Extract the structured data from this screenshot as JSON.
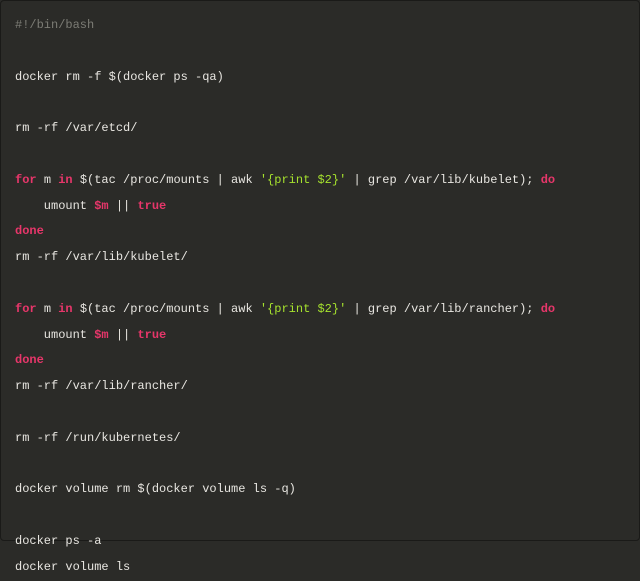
{
  "code": {
    "shebang": "#!/bin/bash",
    "docker_rm": "docker rm -f $(docker ps -qa)",
    "rm_etcd": "rm -rf /var/etcd/",
    "loop1": {
      "for": "for",
      "var": "m",
      "in": "in",
      "expr_pre": " $(tac /proc/mounts | awk ",
      "awk_str": "'{print $2}'",
      "expr_post": " | grep /var/lib/kubelet); ",
      "do": "do",
      "body_pre": "    umount ",
      "body_var": "$m",
      "body_mid": " || ",
      "body_true": "true",
      "done": "done"
    },
    "rm_kubelet": "rm -rf /var/lib/kubelet/",
    "loop2": {
      "for": "for",
      "var": "m",
      "in": "in",
      "expr_pre": " $(tac /proc/mounts | awk ",
      "awk_str": "'{print $2}'",
      "expr_post": " | grep /var/lib/rancher); ",
      "do": "do",
      "body_pre": "    umount ",
      "body_var": "$m",
      "body_mid": " || ",
      "body_true": "true",
      "done": "done"
    },
    "rm_rancher": "rm -rf /var/lib/rancher/",
    "rm_kubernetes": "rm -rf /run/kubernetes/",
    "docker_vol_rm": "docker volume rm $(docker volume ls -q)",
    "docker_ps": "docker ps -a",
    "docker_vol_ls": "docker volume ls"
  }
}
